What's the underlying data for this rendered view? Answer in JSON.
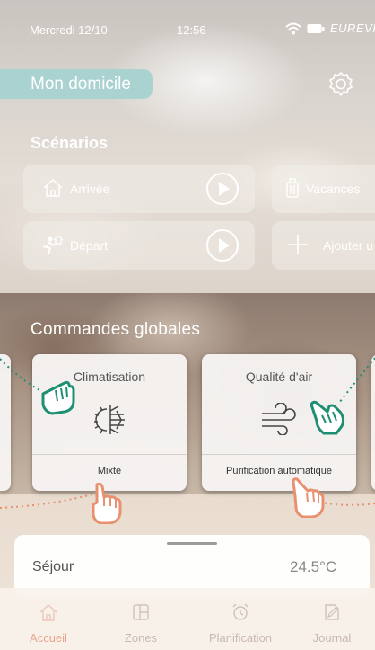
{
  "status_bar": {
    "date": "Mercredi 12/10",
    "time": "12:56",
    "brand": "EUREVIA"
  },
  "header": {
    "home_title": "Mon domicile"
  },
  "scenarios": {
    "title": "Scénarios",
    "items": [
      {
        "label": "Arrivée",
        "icon": "home-icon"
      },
      {
        "label": "Vacances",
        "icon": "suitcase-icon"
      },
      {
        "label": "Départ",
        "icon": "person-leaving-icon"
      },
      {
        "label": "Ajouter u",
        "icon": "plus-icon"
      }
    ]
  },
  "commands": {
    "title": "Commandes globales",
    "cards": [
      {
        "name": "Climatisation",
        "mode": "Mixte",
        "icon": "sun-snowflake-icon"
      },
      {
        "name": "Qualité d'air",
        "mode": "Purification automatique",
        "icon": "wind-icon"
      }
    ]
  },
  "bottom_sheet": {
    "room": "Séjour",
    "temperature": "24.5°C"
  },
  "tabs": [
    {
      "label": "Accueil",
      "icon": "home-icon",
      "active": true
    },
    {
      "label": "Zones",
      "icon": "zones-icon",
      "active": false
    },
    {
      "label": "Planification",
      "icon": "alarm-clock-icon",
      "active": false
    },
    {
      "label": "Journal",
      "icon": "journal-icon",
      "active": false
    }
  ],
  "colors": {
    "accent": "#a9d2d0",
    "tab_active": "#e7a58e",
    "hand_pointer_green": "#1f8f73",
    "hand_pointer_orange": "#e8906f"
  }
}
